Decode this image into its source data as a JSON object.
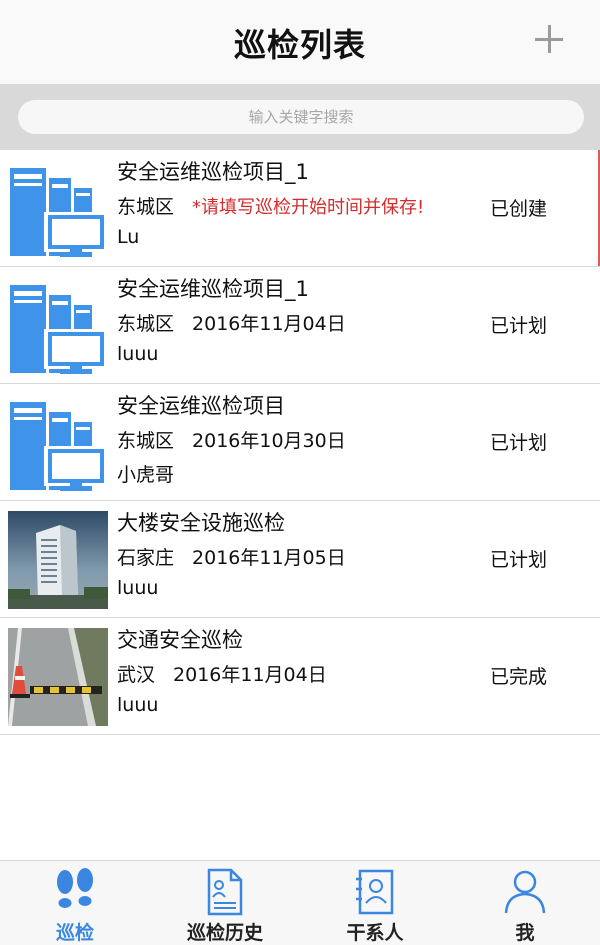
{
  "header": {
    "title": "巡检列表",
    "add_icon": "plus-icon"
  },
  "search": {
    "placeholder": "输入关键字搜索"
  },
  "items": [
    {
      "title": "安全运维巡检项目_1",
      "district": "东城区",
      "date": "",
      "note": "*请填写巡检开始时间并保存!",
      "person": "Lu",
      "status": "已创建",
      "thumb": "server-computer-icon"
    },
    {
      "title": "安全运维巡检项目_1",
      "district": "东城区",
      "date": "2016年11月04日",
      "note": "",
      "person": "luuu",
      "status": "已计划",
      "thumb": "server-computer-icon"
    },
    {
      "title": "安全运维巡检项目",
      "district": "东城区",
      "date": "2016年10月30日",
      "note": "",
      "person": "小虎哥",
      "status": "已计划",
      "thumb": "server-computer-icon"
    },
    {
      "title": "大楼安全设施巡检",
      "district": "石家庄",
      "date": "2016年11月05日",
      "note": "",
      "person": "luuu",
      "status": "已计划",
      "thumb": "building-photo"
    },
    {
      "title": "交通安全巡检",
      "district": "武汉",
      "date": "2016年11月04日",
      "note": "",
      "person": "luuu",
      "status": "已完成",
      "thumb": "road-speed-bump-photo"
    }
  ],
  "tabs": [
    {
      "label": "巡检",
      "icon": "footprints-icon",
      "active": true
    },
    {
      "label": "巡检历史",
      "icon": "document-icon",
      "active": false
    },
    {
      "label": "干系人",
      "icon": "contact-card-icon",
      "active": false
    },
    {
      "label": "我",
      "icon": "person-icon",
      "active": false
    }
  ],
  "colors": {
    "accent": "#3a86e0",
    "warning": "#d62b2b",
    "icon_blue": "#3f93e8"
  }
}
